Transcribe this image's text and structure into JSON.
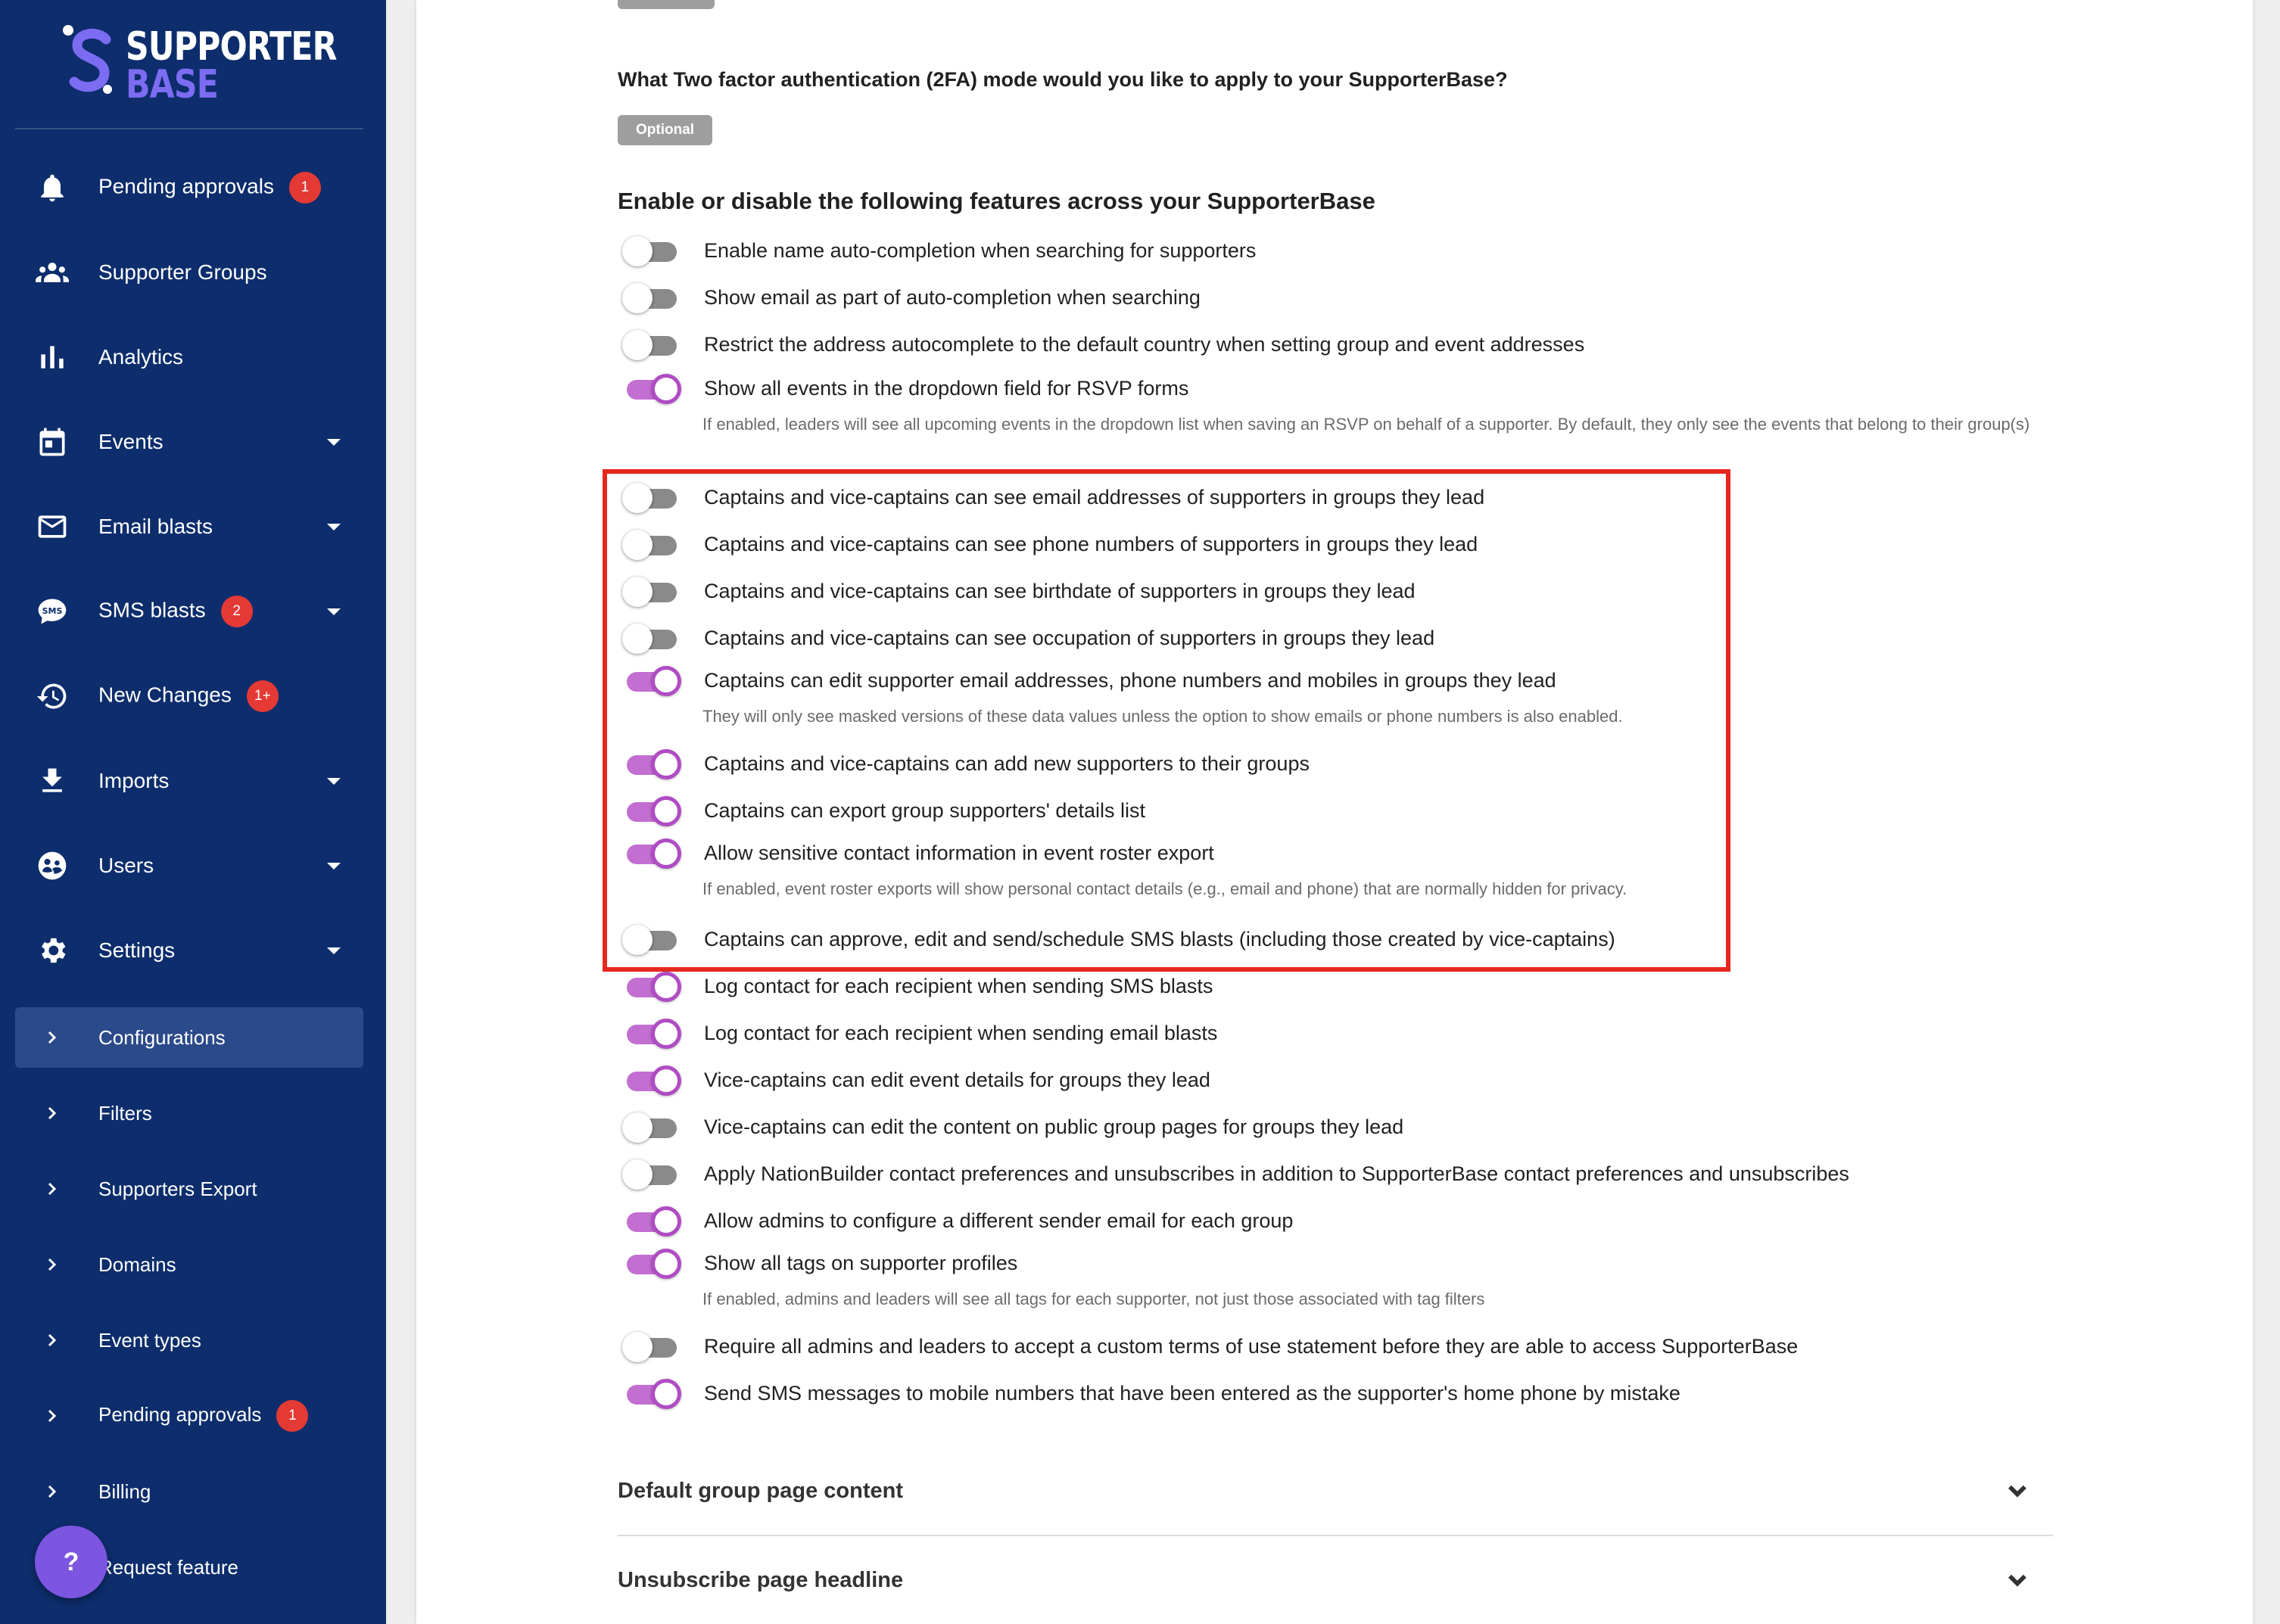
{
  "brand": {
    "line1": "SUPPORTER",
    "line2": "BASE",
    "mark_color": "#7c6cf2"
  },
  "sidebar": {
    "items": [
      {
        "label": "Pending approvals",
        "icon": "bell-icon",
        "badge": "1"
      },
      {
        "label": "Supporter Groups",
        "icon": "groups-icon"
      },
      {
        "label": "Analytics",
        "icon": "bar-chart-icon"
      },
      {
        "label": "Events",
        "icon": "calendar-icon"
      },
      {
        "label": "Email blasts",
        "icon": "mail-icon"
      },
      {
        "label": "SMS blasts",
        "icon": "sms-icon",
        "badge": "2"
      },
      {
        "label": "New Changes",
        "icon": "history-icon",
        "badge": "1+"
      },
      {
        "label": "Imports",
        "icon": "download-icon"
      },
      {
        "label": "Users",
        "icon": "users-icon"
      },
      {
        "label": "Settings",
        "icon": "gear-icon"
      }
    ],
    "sub_items": [
      {
        "label": "Configurations",
        "active": true
      },
      {
        "label": "Filters"
      },
      {
        "label": "Supporters Export"
      },
      {
        "label": "Domains"
      },
      {
        "label": "Event types"
      },
      {
        "label": "Pending approvals",
        "badge": "1"
      },
      {
        "label": "Billing"
      },
      {
        "label": "Request feature"
      }
    ],
    "help_label": "?"
  },
  "main": {
    "two_factor_question": "What Two factor authentication (2FA) mode would you like to apply to your SupporterBase?",
    "two_factor_value": "Optional",
    "features_title": "Enable or disable the following features across your SupporterBase",
    "toggles": [
      {
        "label": "Enable name auto-completion when searching for supporters",
        "on": false
      },
      {
        "label": "Show email as part of auto-completion when searching",
        "on": false
      },
      {
        "label": "Restrict the address autocomplete to the default country when setting group and event addresses",
        "on": false
      },
      {
        "label": "Show all events in the dropdown field for RSVP forms",
        "on": true,
        "description": "If enabled, leaders will see all upcoming events in the dropdown list when saving an RSVP on behalf of a supporter. By default, they only see the events that belong to their group(s)"
      },
      {
        "label": "Captains and vice-captains can see email addresses of supporters in groups they lead",
        "on": false
      },
      {
        "label": "Captains and vice-captains can see phone numbers of supporters in groups they lead",
        "on": false
      },
      {
        "label": "Captains and vice-captains can see birthdate of supporters in groups they lead",
        "on": false
      },
      {
        "label": "Captains and vice-captains can see occupation of supporters in groups they lead",
        "on": false
      },
      {
        "label": "Captains can edit supporter email addresses, phone numbers and mobiles in groups they lead",
        "on": true,
        "description": "They will only see masked versions of these data values unless the option to show emails or phone numbers is also enabled."
      },
      {
        "label": "Captains and vice-captains can add new supporters to their groups",
        "on": true
      },
      {
        "label": "Captains can export group supporters' details list",
        "on": true
      },
      {
        "label": "Allow sensitive contact information in event roster export",
        "on": true,
        "description": "If enabled, event roster exports will show personal contact details (e.g., email and phone) that are normally hidden for privacy."
      },
      {
        "label": "Captains can approve, edit and send/schedule SMS blasts (including those created by vice-captains)",
        "on": false
      },
      {
        "label": "Log contact for each recipient when sending SMS blasts",
        "on": true
      },
      {
        "label": "Log contact for each recipient when sending email blasts",
        "on": true
      },
      {
        "label": "Vice-captains can edit event details for groups they lead",
        "on": true
      },
      {
        "label": "Vice-captains can edit the content on public group pages for groups they lead",
        "on": false
      },
      {
        "label": "Apply NationBuilder contact preferences and unsubscribes in addition to SupporterBase contact preferences and unsubscribes",
        "on": false
      },
      {
        "label": "Allow admins to configure a different sender email for each group",
        "on": true
      },
      {
        "label": "Show all tags on supporter profiles",
        "on": true,
        "description": "If enabled, admins and leaders will see all tags for each supporter, not just those associated with tag filters"
      },
      {
        "label": "Require all admins and leaders to accept a custom terms of use statement before they are able to access SupporterBase",
        "on": false
      },
      {
        "label": "Send SMS messages to mobile numbers that have been entered as the supporter's home phone by mistake",
        "on": true
      }
    ],
    "accordions": [
      {
        "label": "Default group page content"
      },
      {
        "label": "Unsubscribe page headline"
      }
    ]
  },
  "colors": {
    "sidebar_bg": "#0d2d6c",
    "toggle_on": "#b04cc4",
    "badge": "#e53935",
    "highlight": "#e5281e"
  }
}
